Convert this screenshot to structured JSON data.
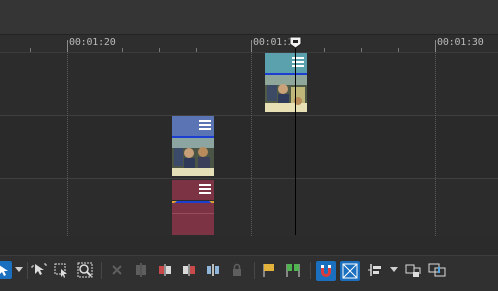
{
  "ruler": {
    "labels": [
      "00:01:20",
      "00:01:2",
      "00:01:30"
    ]
  },
  "clips": {
    "top": {
      "color": "#5aa0ad"
    },
    "middle": {
      "color": "#5b74b3"
    },
    "bottom": {
      "color": "#7c3344"
    }
  },
  "playhead": {
    "color": "#000000"
  },
  "toolbar": {
    "items": [
      {
        "name": "normal-edit-tool-icon",
        "state": "active"
      },
      {
        "name": "select-tool-icon",
        "state": "normal"
      },
      {
        "name": "envelope-tool-icon",
        "state": "normal"
      },
      {
        "name": "zoom-tool-icon",
        "state": "normal"
      },
      {
        "name": "delete-icon",
        "state": "disabled"
      },
      {
        "name": "trim-start-icon",
        "state": "disabled"
      },
      {
        "name": "trim-end-icon",
        "state": "normal"
      },
      {
        "name": "split-icon",
        "state": "normal"
      },
      {
        "name": "split-center-icon",
        "state": "normal"
      },
      {
        "name": "lock-icon",
        "state": "disabled"
      },
      {
        "name": "marker-icon",
        "state": "normal"
      },
      {
        "name": "region-icon",
        "state": "normal"
      },
      {
        "name": "snapping-icon",
        "state": "active"
      },
      {
        "name": "auto-crossfade-icon",
        "state": "active"
      },
      {
        "name": "ripple-edit-icon",
        "state": "normal"
      },
      {
        "name": "lock-envelopes-icon",
        "state": "normal"
      },
      {
        "name": "ignore-grouping-icon",
        "state": "normal"
      }
    ]
  }
}
